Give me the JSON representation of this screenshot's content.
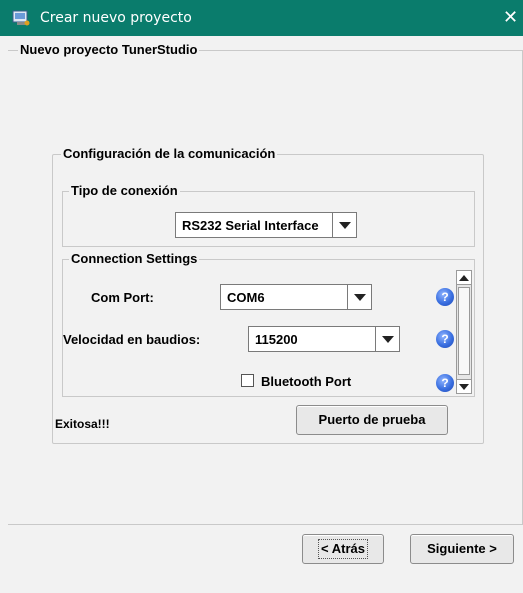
{
  "window": {
    "title": "Crear nuevo proyecto",
    "close_glyph": "✕",
    "icon": "app-window-icon",
    "titlebar_color": "#0a7c6c"
  },
  "main": {
    "legend": "Nuevo proyecto TunerStudio"
  },
  "comm": {
    "legend": "Configuración de la comunicación",
    "connection_type": {
      "legend": "Tipo de conexión",
      "selected": "RS232 Serial Interface"
    },
    "settings": {
      "legend": "Connection Settings",
      "com_port_label": "Com Port:",
      "com_port_value": "COM6",
      "baud_label": "Velocidad en baudios:",
      "baud_value": "115200",
      "bluetooth_label": "Bluetooth Port",
      "bluetooth_checked": false,
      "help_glyph": "?"
    },
    "status": "Exitosa!!!",
    "test_button": "Puerto de prueba"
  },
  "footer": {
    "back_button": "< Atrás",
    "next_button": "Siguiente >"
  }
}
